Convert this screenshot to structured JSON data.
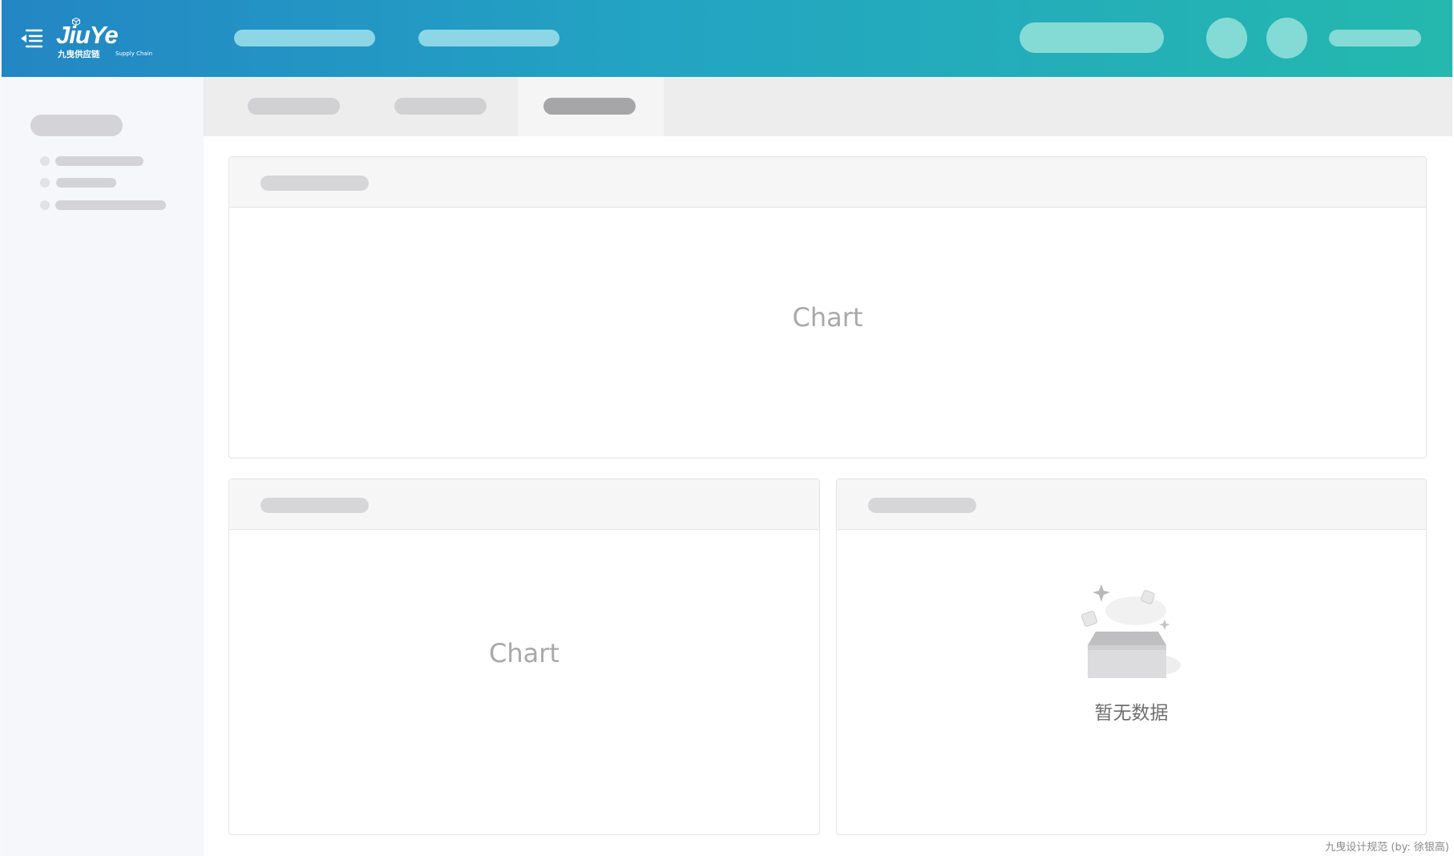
{
  "header": {
    "logo": {
      "wordmark": "JiuYe",
      "cn": "九曳供应链",
      "en": "Supply Chain"
    },
    "icons": {
      "menu": "menu-collapse-icon",
      "cube": "cube-icon"
    },
    "colors": {
      "gradient_start": "#2386c4",
      "gradient_end": "#24b8ae"
    }
  },
  "main": {
    "tabs": [
      {
        "active": false
      },
      {
        "active": false
      },
      {
        "active": true
      }
    ],
    "cards": [
      {
        "placeholder": "Chart"
      },
      {
        "placeholder": "Chart"
      },
      {
        "empty_text": "暂无数据",
        "icon": "empty-box-icon"
      }
    ]
  },
  "footer": {
    "credit": "九曳设计规范 (by: 徐银高)"
  }
}
